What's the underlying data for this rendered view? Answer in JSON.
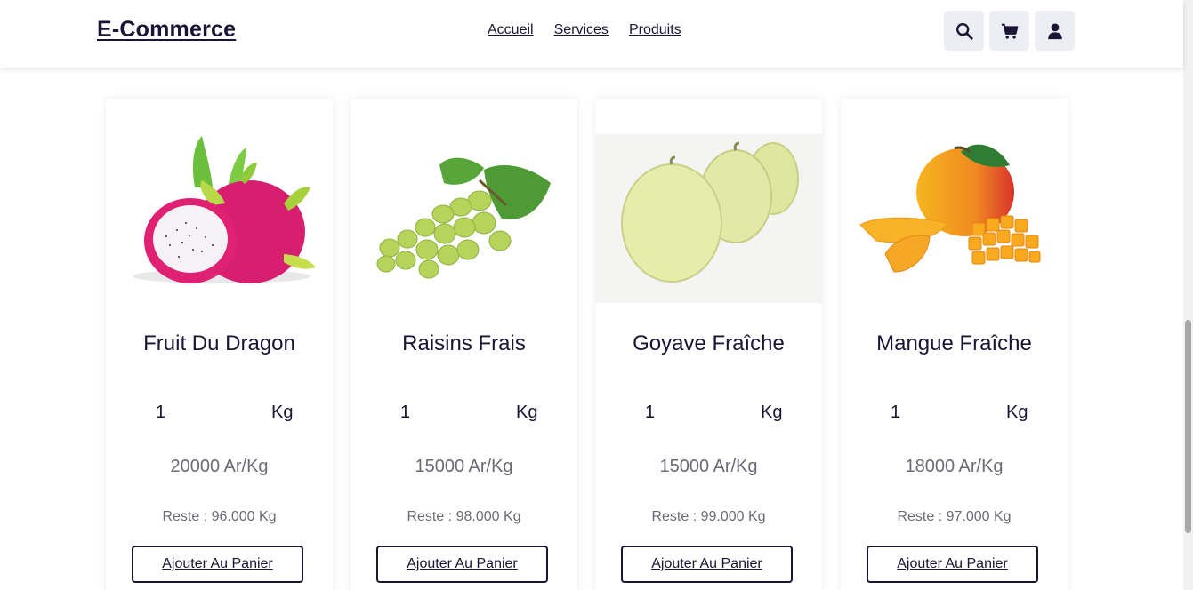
{
  "header": {
    "logo": "E-Commerce",
    "nav": [
      "Accueil",
      "Services",
      "Produits"
    ],
    "icons": [
      "search-icon",
      "cart-icon",
      "user-icon"
    ]
  },
  "products": [
    {
      "name": "Fruit Du Dragon",
      "qty": "1",
      "unit": "Kg",
      "price": "20000 Ar/Kg",
      "stock": "Reste : 96.000 Kg",
      "button": "Ajouter Au Panier"
    },
    {
      "name": "Raisins Frais",
      "qty": "1",
      "unit": "Kg",
      "price": "15000 Ar/Kg",
      "stock": "Reste : 98.000 Kg",
      "button": "Ajouter Au Panier"
    },
    {
      "name": "Goyave Fraîche",
      "qty": "1",
      "unit": "Kg",
      "price": "15000 Ar/Kg",
      "stock": "Reste : 99.000 Kg",
      "button": "Ajouter Au Panier"
    },
    {
      "name": "Mangue Fraîche",
      "qty": "1",
      "unit": "Kg",
      "price": "18000 Ar/Kg",
      "stock": "Reste : 97.000 Kg",
      "button": "Ajouter Au Panier"
    }
  ],
  "colors": {
    "primary": "#1a1535",
    "muted": "#6b6b75",
    "icon_bg": "#eceef3"
  }
}
